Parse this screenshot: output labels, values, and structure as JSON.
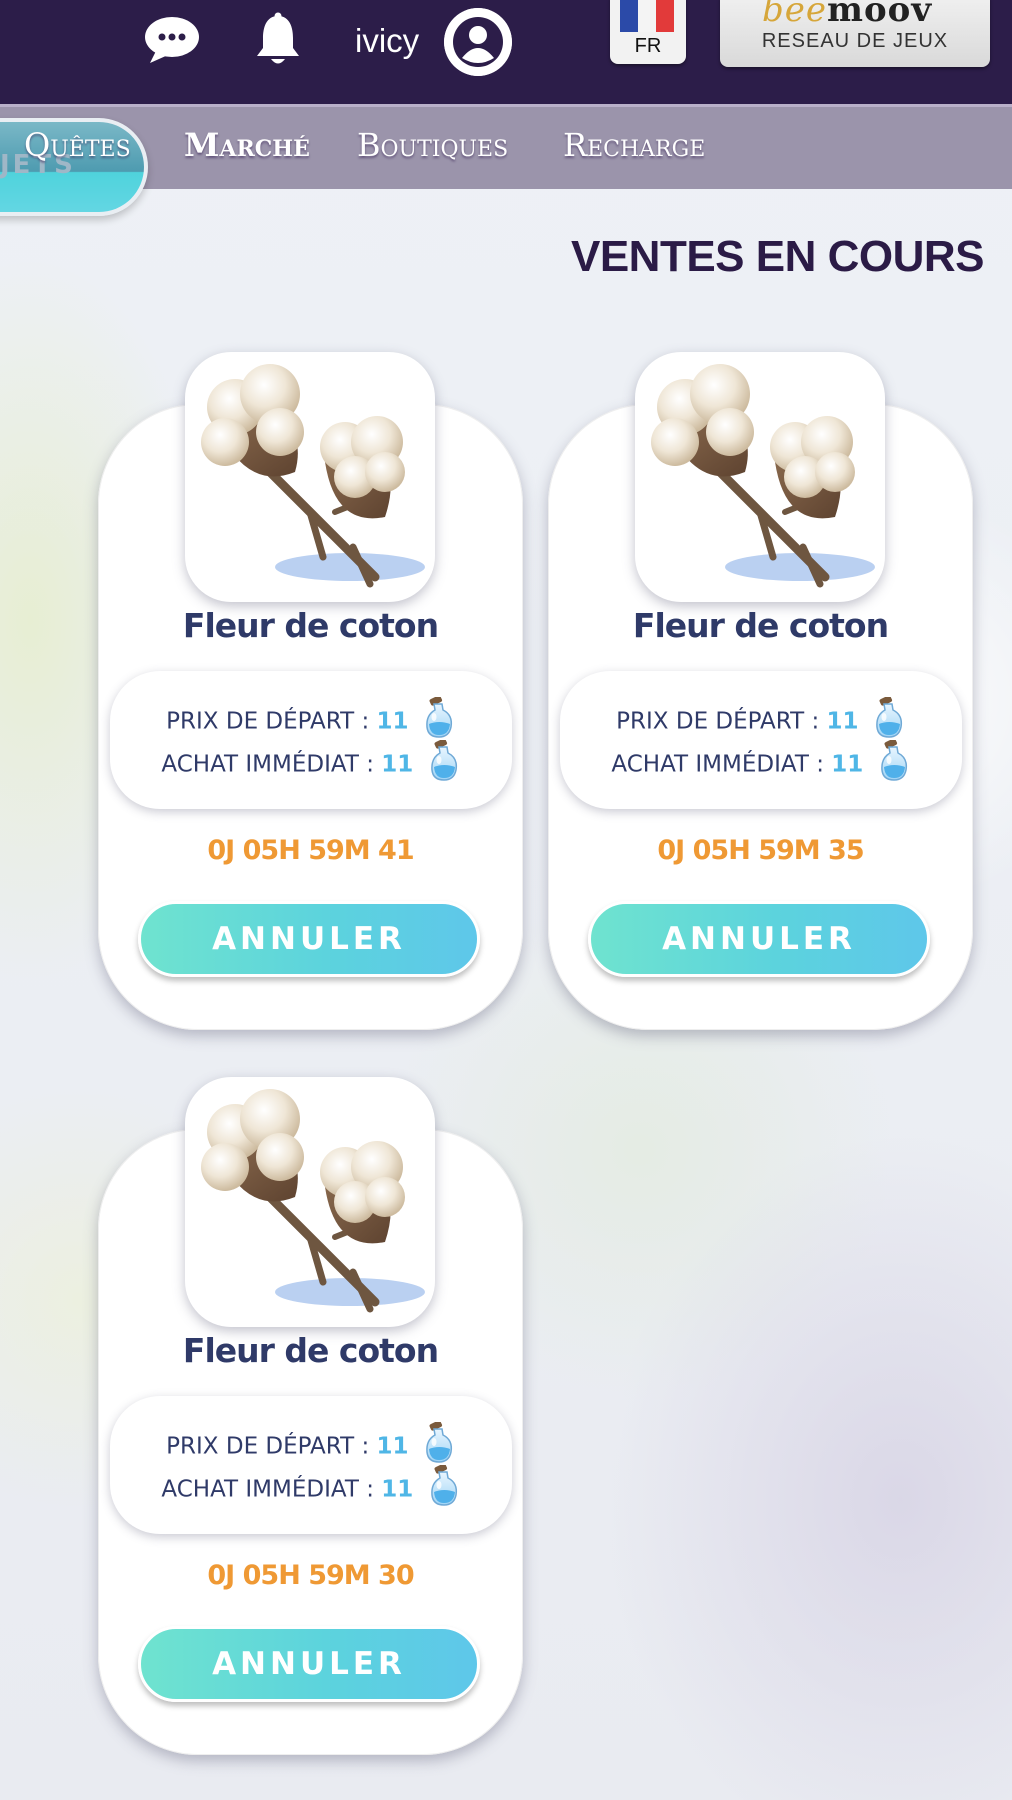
{
  "header": {
    "username": "ivicy",
    "language_code": "FR",
    "brand": {
      "prefix": "bee",
      "name": "moov",
      "tagline": "RESEAU DE JEUX"
    }
  },
  "nav": {
    "partial_tab_text": "JETS",
    "items": [
      {
        "label": "Quêtes",
        "active": false
      },
      {
        "label": "Marché",
        "active": true
      },
      {
        "label": "Boutiques",
        "active": false
      },
      {
        "label": "Recharge",
        "active": false
      }
    ]
  },
  "section_title": "VENTES EN COURS",
  "sales": [
    {
      "name": "Fleur de coton",
      "start_label": "PRIX DE DÉPART :",
      "start_price": "11",
      "buy_label": "ACHAT IMMÉDIAT :",
      "buy_price": "11",
      "timer": "0J 05H 59M 41",
      "cancel_label": "ANNULER"
    },
    {
      "name": "Fleur de coton",
      "start_label": "PRIX DE DÉPART :",
      "start_price": "11",
      "buy_label": "ACHAT IMMÉDIAT :",
      "buy_price": "11",
      "timer": "0J 05H 59M 35",
      "cancel_label": "ANNULER"
    },
    {
      "name": "Fleur de coton",
      "start_label": "PRIX DE DÉPART :",
      "start_price": "11",
      "buy_label": "ACHAT IMMÉDIAT :",
      "buy_price": "11",
      "timer": "0J 05H 59M 30",
      "cancel_label": "ANNULER"
    }
  ],
  "icons": {
    "chat": "chat-bubble-icon",
    "notifications": "bell-icon",
    "profile": "user-avatar-icon",
    "currency": "potion-icon",
    "item": "cotton-flower-icon"
  },
  "colors": {
    "topbar": "#2c1d49",
    "navbar": "#9b94ab",
    "title": "#2b1b46",
    "item_name": "#2f3a68",
    "price_value": "#4fb6e6",
    "timer": "#ef9934",
    "button_gradient_start": "#6fe3cf",
    "button_gradient_end": "#5ec7ea"
  }
}
